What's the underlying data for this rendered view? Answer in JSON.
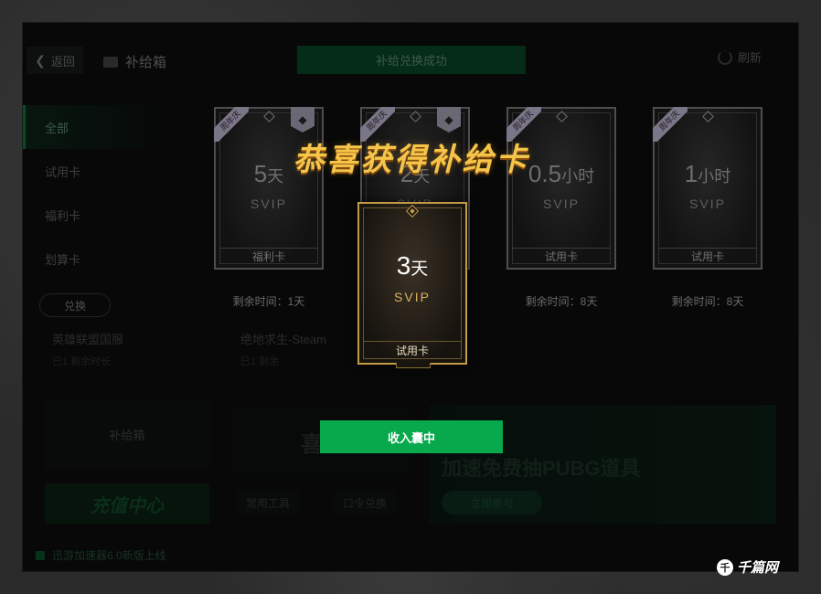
{
  "app": {
    "back_label": "返回",
    "title": "补给箱",
    "success_banner": "补给兑换成功",
    "refresh_label": "刷新"
  },
  "sidebar": {
    "items": [
      {
        "label": "全部"
      },
      {
        "label": "试用卡"
      },
      {
        "label": "福利卡"
      },
      {
        "label": "划算卡"
      }
    ],
    "exchange_label": "兑换",
    "supply_box_label": "补给箱",
    "recharge_label": "充值中心",
    "footer_note": "迅游加速器6.0新版上线"
  },
  "background": {
    "game_1": "英雄联盟国服",
    "game_1_sub": "已1 剩余时长",
    "game_2": "绝地求生-Steam",
    "game_2_sub": "已1 剩余",
    "promo_left": "喜加",
    "promo_right_text": "加速免费抽PUBG道具",
    "promo_right_button": "立即参与",
    "tool_1": "常用工具",
    "tool_2": "口令兑换"
  },
  "cards": [
    {
      "ribbon": "周年庆",
      "value": "5",
      "unit": "天",
      "svip": "SVIP",
      "type": "福利卡",
      "remain": "剩余时间：1天",
      "gem": true
    },
    {
      "ribbon": "周年庆",
      "value": "2",
      "unit": "天",
      "svip": "SVIP",
      "type": "",
      "remain": "",
      "gem": true
    },
    {
      "ribbon": "周年庆",
      "value": "0.5",
      "unit": "小时",
      "svip": "SVIP",
      "type": "试用卡",
      "remain": "剩余时间：8天",
      "gem": false
    },
    {
      "ribbon": "周年庆",
      "value": "1",
      "unit": "小时",
      "svip": "SVIP",
      "type": "试用卡",
      "remain": "剩余时间：8天",
      "gem": false
    }
  ],
  "popup": {
    "title": "恭喜获得补给卡",
    "card": {
      "value": "3",
      "unit": "天",
      "svip": "SVIP",
      "type": "试用卡"
    },
    "collect_label": "收入囊中"
  },
  "watermark": {
    "icon": "千",
    "text": "千篇网"
  },
  "colors": {
    "accent": "#08a84c",
    "gold": "#c39b45",
    "title_gold": "#f5c54a"
  }
}
